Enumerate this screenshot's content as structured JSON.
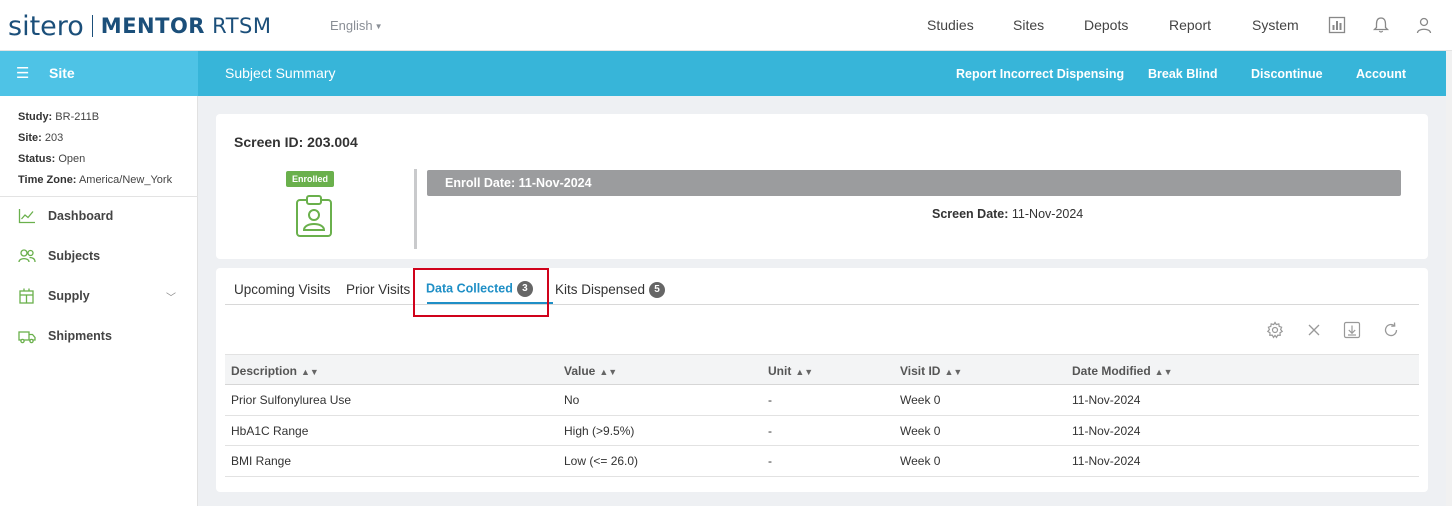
{
  "header": {
    "logo_text": "sitero",
    "product_bold": "MENTOR",
    "product_light": " RTSM",
    "language": "English",
    "nav": [
      "Studies",
      "Sites",
      "Depots",
      "Report",
      "System"
    ]
  },
  "sidebar": {
    "title": "Site",
    "info": [
      {
        "label": "Study:",
        "value": "BR-211B"
      },
      {
        "label": "Site:",
        "value": "203"
      },
      {
        "label": "Status:",
        "value": "Open"
      },
      {
        "label": "Time Zone:",
        "value": "America/New_York"
      }
    ],
    "items": [
      {
        "label": "Dashboard",
        "icon": "chart-icon"
      },
      {
        "label": "Subjects",
        "icon": "users-icon"
      },
      {
        "label": "Supply",
        "icon": "box-icon"
      },
      {
        "label": "Shipments",
        "icon": "truck-icon"
      }
    ]
  },
  "subheader": {
    "title": "Subject Summary",
    "actions": [
      "Report Incorrect Dispensing",
      "Break Blind",
      "Discontinue",
      "Account"
    ]
  },
  "subject": {
    "screen_id": "Screen ID: 203.004",
    "status": "Enrolled",
    "enroll_date": "Enroll Date: 11-Nov-2024",
    "screen_date_label": "Screen Date:",
    "screen_date_value": " 11-Nov-2024"
  },
  "tabs": [
    {
      "label": "Upcoming Visits",
      "count": ""
    },
    {
      "label": "Prior Visits",
      "count": ""
    },
    {
      "label": "Data Collected",
      "count": "3"
    },
    {
      "label": "Kits Dispensed",
      "count": "5"
    }
  ],
  "table": {
    "columns": [
      "Description",
      "Value",
      "Unit",
      "Visit ID",
      "Date Modified"
    ],
    "rows": [
      [
        "Prior Sulfonylurea Use",
        "No",
        "-",
        "Week 0",
        "11-Nov-2024"
      ],
      [
        "HbA1C Range",
        "High (>9.5%)",
        "-",
        "Week 0",
        "11-Nov-2024"
      ],
      [
        "BMI Range",
        "Low (<= 26.0)",
        "-",
        "Week 0",
        "11-Nov-2024"
      ]
    ]
  },
  "colors": {
    "brand": "#1b4f7a",
    "sidebar_header": "#4ec3e6",
    "subheader": "#37b5d9",
    "active_tab": "#1f8fc6",
    "enrolled_badge": "#6ab04c",
    "highlight": "#d0021b"
  }
}
